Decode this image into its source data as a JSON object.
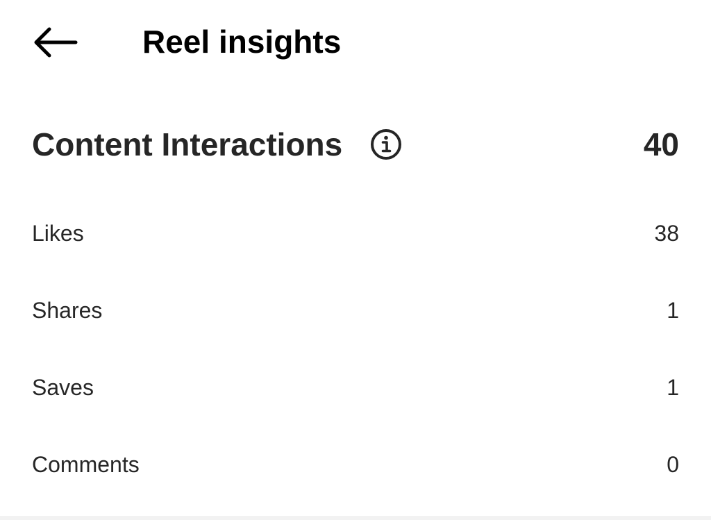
{
  "header": {
    "back_icon": "arrow-left-icon",
    "title": "Reel insights"
  },
  "content_interactions": {
    "title": "Content Interactions",
    "info_icon": "info-circle-icon",
    "total": "40",
    "metrics": [
      {
        "label": "Likes",
        "value": "38"
      },
      {
        "label": "Shares",
        "value": "1"
      },
      {
        "label": "Saves",
        "value": "1"
      },
      {
        "label": "Comments",
        "value": "0"
      }
    ]
  },
  "colors": {
    "text_primary": "#262626",
    "title": "#000000",
    "background": "#ffffff"
  }
}
